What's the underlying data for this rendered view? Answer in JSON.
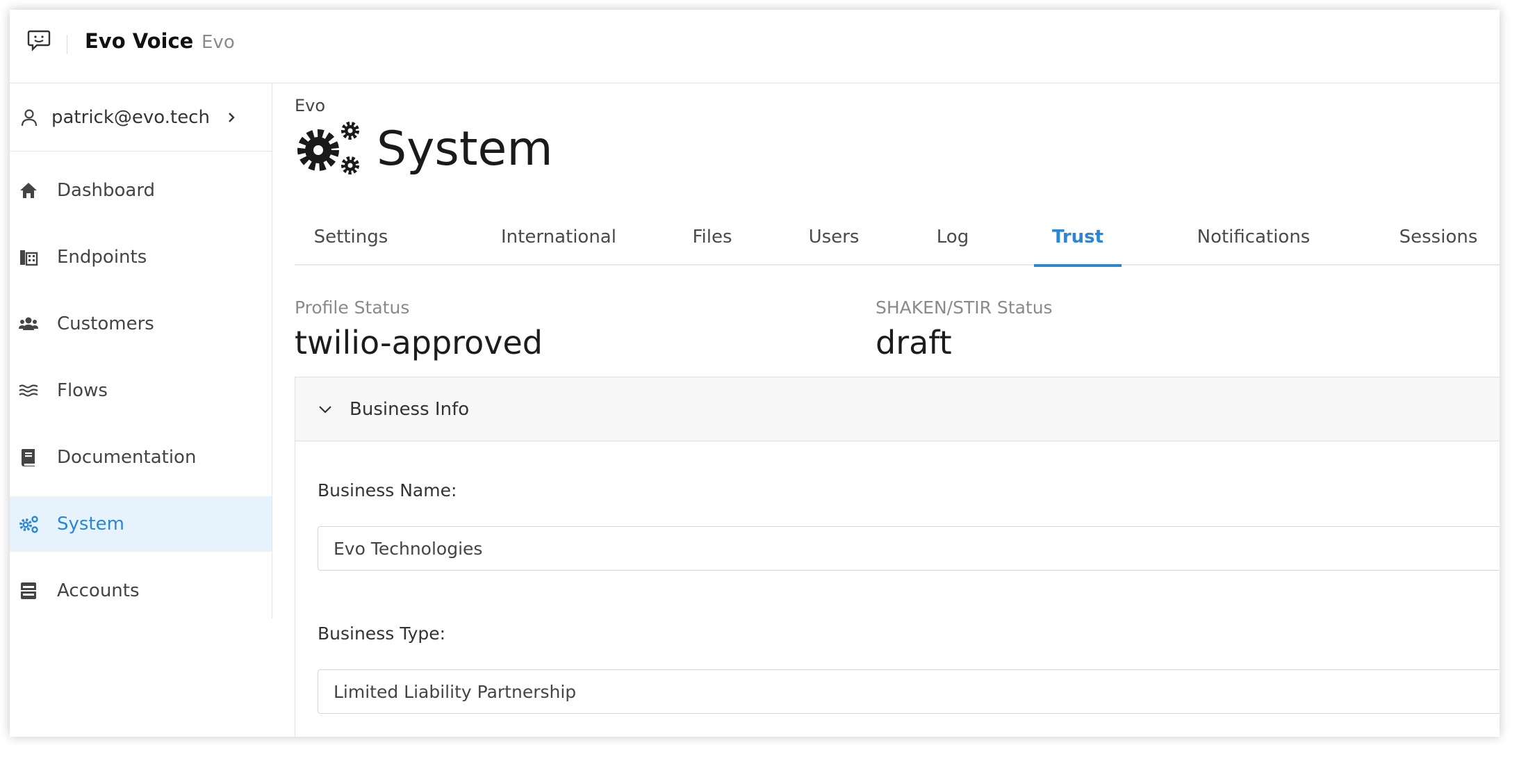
{
  "header": {
    "app_title": "Evo Voice",
    "app_subtitle": "Evo"
  },
  "sidebar": {
    "user": "patrick@evo.tech",
    "items": [
      {
        "label": "Dashboard",
        "icon": "home-icon"
      },
      {
        "label": "Endpoints",
        "icon": "endpoints-icon"
      },
      {
        "label": "Customers",
        "icon": "users-icon"
      },
      {
        "label": "Flows",
        "icon": "flows-icon"
      },
      {
        "label": "Documentation",
        "icon": "book-icon"
      },
      {
        "label": "System",
        "icon": "gears-icon",
        "active": true
      },
      {
        "label": "Accounts",
        "icon": "accounts-icon"
      }
    ]
  },
  "main": {
    "breadcrumb": "Evo",
    "title": "System",
    "tabs": [
      {
        "label": "Settings"
      },
      {
        "label": "International"
      },
      {
        "label": "Files"
      },
      {
        "label": "Users"
      },
      {
        "label": "Log"
      },
      {
        "label": "Trust",
        "active": true
      },
      {
        "label": "Notifications"
      },
      {
        "label": "Sessions"
      }
    ],
    "profile_status": {
      "label": "Profile Status",
      "value": "twilio-approved"
    },
    "shaken_status": {
      "label": "SHAKEN/STIR Status",
      "value": "draft"
    },
    "panel": {
      "title": "Business Info",
      "business_name": {
        "label": "Business Name:",
        "value": "Evo Technologies"
      },
      "business_type": {
        "label": "Business Type:",
        "value": "Limited Liability Partnership"
      }
    }
  },
  "colors": {
    "accent": "#2b86d6",
    "active_bg": "#e6f3fd"
  }
}
